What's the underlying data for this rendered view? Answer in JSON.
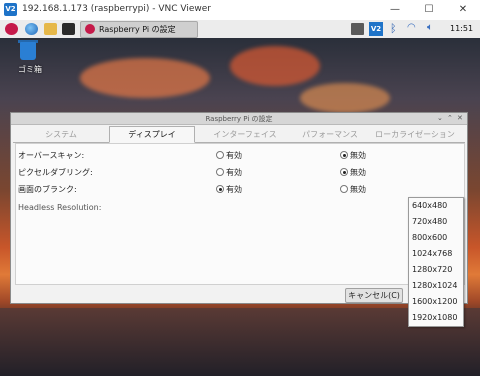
{
  "window": {
    "title": "192.168.1.173 (raspberrypi) - VNC Viewer",
    "logo_text": "V2",
    "minimize": "—",
    "maximize": "☐",
    "close": "✕"
  },
  "panel": {
    "task_label": "Raspberry Pi の設定",
    "clock": "11:51",
    "tray_logo": "V2"
  },
  "desktop": {
    "trash_label": "ゴミ箱"
  },
  "dialog": {
    "title": "Raspberry Pi の設定",
    "controls": [
      "⌄",
      "⌃",
      "✕"
    ],
    "tabs": [
      "システム",
      "ディスプレイ",
      "インターフェイス",
      "パフォーマンス",
      "ローカライゼーション"
    ],
    "active_tab": "ディスプレイ",
    "rows": [
      {
        "label": "オーバースキャン:",
        "option_a": "有効",
        "option_b": "無効",
        "selected": "b"
      },
      {
        "label": "ピクセルダブリング:",
        "option_a": "有効",
        "option_b": "無効",
        "selected": "b"
      },
      {
        "label": "画面のブランク:",
        "option_a": "有効",
        "option_b": "無効",
        "selected": "a"
      }
    ],
    "headless_label": "Headless Resolution:",
    "cancel": "キャンセル(C)"
  },
  "dropdown": {
    "options": [
      "640x480",
      "720x480",
      "800x600",
      "1024x768",
      "1280x720",
      "1280x1024",
      "1600x1200",
      "1920x1080"
    ]
  }
}
